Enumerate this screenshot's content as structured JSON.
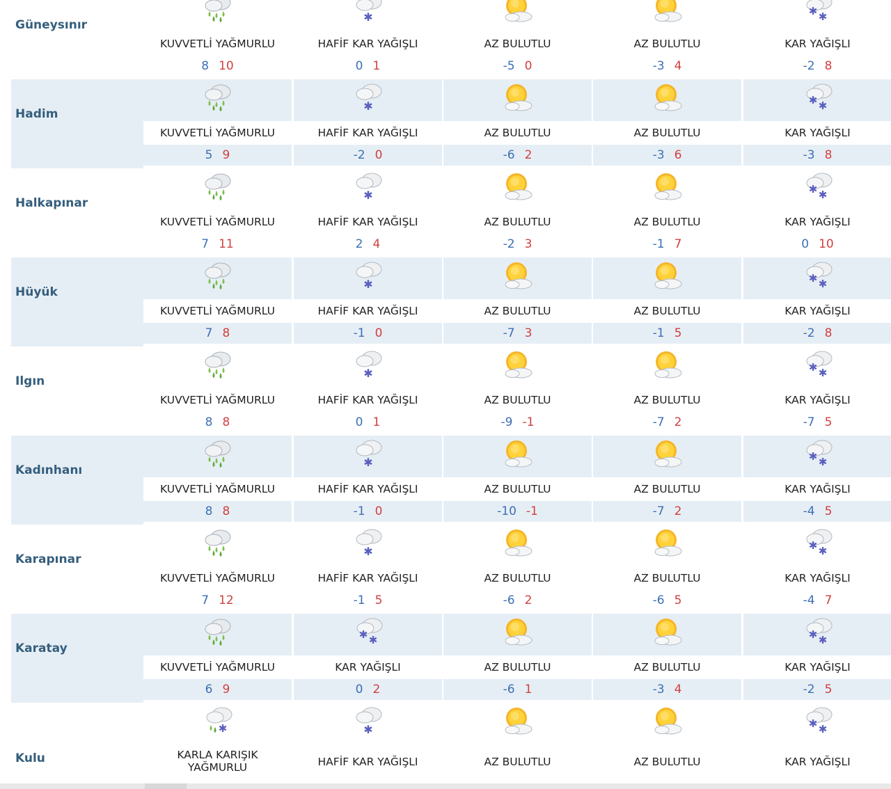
{
  "rows": [
    {
      "city": "Güneysınır",
      "days": [
        {
          "icon": "heavy-rain-icon",
          "desc": "KUVVETLİ YAĞMURLU",
          "min": "8",
          "max": "10"
        },
        {
          "icon": "light-snow-icon",
          "desc": "HAFİF KAR YAĞIŞLI",
          "min": "0",
          "max": "1"
        },
        {
          "icon": "partly-cloudy-icon",
          "desc": "AZ BULUTLU",
          "min": "-5",
          "max": "0"
        },
        {
          "icon": "partly-cloudy-icon",
          "desc": "AZ BULUTLU",
          "min": "-3",
          "max": "4"
        },
        {
          "icon": "snow-icon",
          "desc": "KAR YAĞIŞLI",
          "min": "-2",
          "max": "8"
        }
      ]
    },
    {
      "city": "Hadim",
      "days": [
        {
          "icon": "heavy-rain-icon",
          "desc": "KUVVETLİ YAĞMURLU",
          "min": "5",
          "max": "9"
        },
        {
          "icon": "light-snow-icon",
          "desc": "HAFİF KAR YAĞIŞLI",
          "min": "-2",
          "max": "0"
        },
        {
          "icon": "partly-cloudy-icon",
          "desc": "AZ BULUTLU",
          "min": "-6",
          "max": "2"
        },
        {
          "icon": "partly-cloudy-icon",
          "desc": "AZ BULUTLU",
          "min": "-3",
          "max": "6"
        },
        {
          "icon": "snow-icon",
          "desc": "KAR YAĞIŞLI",
          "min": "-3",
          "max": "8"
        }
      ]
    },
    {
      "city": "Halkapınar",
      "days": [
        {
          "icon": "heavy-rain-icon",
          "desc": "KUVVETLİ YAĞMURLU",
          "min": "7",
          "max": "11"
        },
        {
          "icon": "light-snow-icon",
          "desc": "HAFİF KAR YAĞIŞLI",
          "min": "2",
          "max": "4"
        },
        {
          "icon": "partly-cloudy-icon",
          "desc": "AZ BULUTLU",
          "min": "-2",
          "max": "3"
        },
        {
          "icon": "partly-cloudy-icon",
          "desc": "AZ BULUTLU",
          "min": "-1",
          "max": "7"
        },
        {
          "icon": "snow-icon",
          "desc": "KAR YAĞIŞLI",
          "min": "0",
          "max": "10"
        }
      ]
    },
    {
      "city": "Hüyük",
      "days": [
        {
          "icon": "heavy-rain-icon",
          "desc": "KUVVETLİ YAĞMURLU",
          "min": "7",
          "max": "8"
        },
        {
          "icon": "light-snow-icon",
          "desc": "HAFİF KAR YAĞIŞLI",
          "min": "-1",
          "max": "0"
        },
        {
          "icon": "partly-cloudy-icon",
          "desc": "AZ BULUTLU",
          "min": "-7",
          "max": "3"
        },
        {
          "icon": "partly-cloudy-icon",
          "desc": "AZ BULUTLU",
          "min": "-1",
          "max": "5"
        },
        {
          "icon": "snow-icon",
          "desc": "KAR YAĞIŞLI",
          "min": "-2",
          "max": "8"
        }
      ]
    },
    {
      "city": "Ilgın",
      "days": [
        {
          "icon": "heavy-rain-icon",
          "desc": "KUVVETLİ YAĞMURLU",
          "min": "8",
          "max": "8"
        },
        {
          "icon": "light-snow-icon",
          "desc": "HAFİF KAR YAĞIŞLI",
          "min": "0",
          "max": "1"
        },
        {
          "icon": "partly-cloudy-icon",
          "desc": "AZ BULUTLU",
          "min": "-9",
          "max": "-1"
        },
        {
          "icon": "partly-cloudy-icon",
          "desc": "AZ BULUTLU",
          "min": "-7",
          "max": "2"
        },
        {
          "icon": "snow-icon",
          "desc": "KAR YAĞIŞLI",
          "min": "-7",
          "max": "5"
        }
      ]
    },
    {
      "city": "Kadınhanı",
      "days": [
        {
          "icon": "heavy-rain-icon",
          "desc": "KUVVETLİ YAĞMURLU",
          "min": "8",
          "max": "8"
        },
        {
          "icon": "light-snow-icon",
          "desc": "HAFİF KAR YAĞIŞLI",
          "min": "-1",
          "max": "0"
        },
        {
          "icon": "partly-cloudy-icon",
          "desc": "AZ BULUTLU",
          "min": "-10",
          "max": "-1"
        },
        {
          "icon": "partly-cloudy-icon",
          "desc": "AZ BULUTLU",
          "min": "-7",
          "max": "2"
        },
        {
          "icon": "snow-icon",
          "desc": "KAR YAĞIŞLI",
          "min": "-4",
          "max": "5"
        }
      ]
    },
    {
      "city": "Karapınar",
      "days": [
        {
          "icon": "heavy-rain-icon",
          "desc": "KUVVETLİ YAĞMURLU",
          "min": "7",
          "max": "12"
        },
        {
          "icon": "light-snow-icon",
          "desc": "HAFİF KAR YAĞIŞLI",
          "min": "-1",
          "max": "5"
        },
        {
          "icon": "partly-cloudy-icon",
          "desc": "AZ BULUTLU",
          "min": "-6",
          "max": "2"
        },
        {
          "icon": "partly-cloudy-icon",
          "desc": "AZ BULUTLU",
          "min": "-6",
          "max": "5"
        },
        {
          "icon": "snow-icon",
          "desc": "KAR YAĞIŞLI",
          "min": "-4",
          "max": "7"
        }
      ]
    },
    {
      "city": "Karatay",
      "days": [
        {
          "icon": "heavy-rain-icon",
          "desc": "KUVVETLİ YAĞMURLU",
          "min": "6",
          "max": "9"
        },
        {
          "icon": "snow-icon",
          "desc": "KAR YAĞIŞLI",
          "min": "0",
          "max": "2"
        },
        {
          "icon": "partly-cloudy-icon",
          "desc": "AZ BULUTLU",
          "min": "-6",
          "max": "1"
        },
        {
          "icon": "partly-cloudy-icon",
          "desc": "AZ BULUTLU",
          "min": "-3",
          "max": "4"
        },
        {
          "icon": "snow-icon",
          "desc": "KAR YAĞIŞLI",
          "min": "-2",
          "max": "5"
        }
      ]
    },
    {
      "city": "Kulu",
      "days": [
        {
          "icon": "sleet-icon",
          "desc": "KARLA KARIŞIK YAĞMURLU",
          "min": "",
          "max": ""
        },
        {
          "icon": "light-snow-icon",
          "desc": "HAFİF KAR YAĞIŞLI",
          "min": "",
          "max": ""
        },
        {
          "icon": "partly-cloudy-icon",
          "desc": "AZ BULUTLU",
          "min": "",
          "max": ""
        },
        {
          "icon": "partly-cloudy-icon",
          "desc": "AZ BULUTLU",
          "min": "",
          "max": ""
        },
        {
          "icon": "snow-icon",
          "desc": "KAR YAĞIŞLI",
          "min": "",
          "max": ""
        }
      ]
    }
  ],
  "colors": {
    "city": "#355e7d",
    "min": "#3b6fb6",
    "max": "#d04040",
    "band": "#e6eef5"
  }
}
